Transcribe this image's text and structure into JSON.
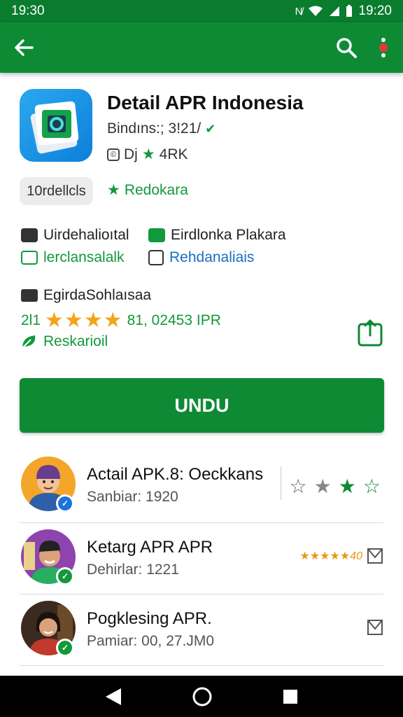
{
  "status_bar": {
    "time_left": "19:30",
    "time_right": "19:20"
  },
  "app_bar": {
    "back_icon": "arrow-left-icon",
    "search_icon": "search-icon",
    "menu_icon": "more-vert-icon"
  },
  "app": {
    "title": "Detail APR Indonesia",
    "meta_line_1": "Bindıns:; 3!21/",
    "meta_line_2": "Dj",
    "meta_line_2_rating": "4RK",
    "chip_label": "10rdellcls",
    "green_label": "Redokara",
    "features": [
      {
        "label": "Uirdehalioıtal",
        "icon": "card-icon",
        "style": "dark"
      },
      {
        "label": "Eirdlonka Plakara",
        "icon": "mail-icon",
        "style": "dark-green-icon"
      },
      {
        "label": "lerclansalalk",
        "icon": "check-box-icon",
        "style": "green"
      },
      {
        "label": "Rehdanaliais",
        "icon": "empty-box-icon",
        "style": "blue"
      }
    ],
    "section_title": "EgirdaSohlaısaa",
    "rating_prefix": "2l1",
    "rating_stars": "★★★★",
    "rating_text": "81, 02453 IPR",
    "recommended_label": "Reskarioil",
    "install_label": "UNDU"
  },
  "related": [
    {
      "title": "Actail APK.8: Oeckkans",
      "subtitle": "Sanbiar: 1920",
      "stars": [
        "☆",
        "★",
        "★",
        "☆"
      ],
      "badge_color": "#1a73d9",
      "badge_glyph": "✓"
    },
    {
      "title": "Ketarg APR APR",
      "subtitle": "Dehirlar: 1221",
      "mini_rating": "★★★★★",
      "mini_rating_label": "40",
      "badge_color": "#12993c",
      "badge_glyph": "✓"
    },
    {
      "title": "Pogklesing APR.",
      "subtitle": "Pamiar: 00, 27.JM0",
      "badge_color": "#12993c",
      "badge_glyph": "✓"
    }
  ],
  "colors": {
    "primary": "#0e8a35",
    "status_bar": "#0a7c2e",
    "accent_star": "#f2a51a"
  },
  "nav_bar": {
    "back": "nav-back-icon",
    "home": "nav-home-icon",
    "recents": "nav-recents-icon"
  }
}
